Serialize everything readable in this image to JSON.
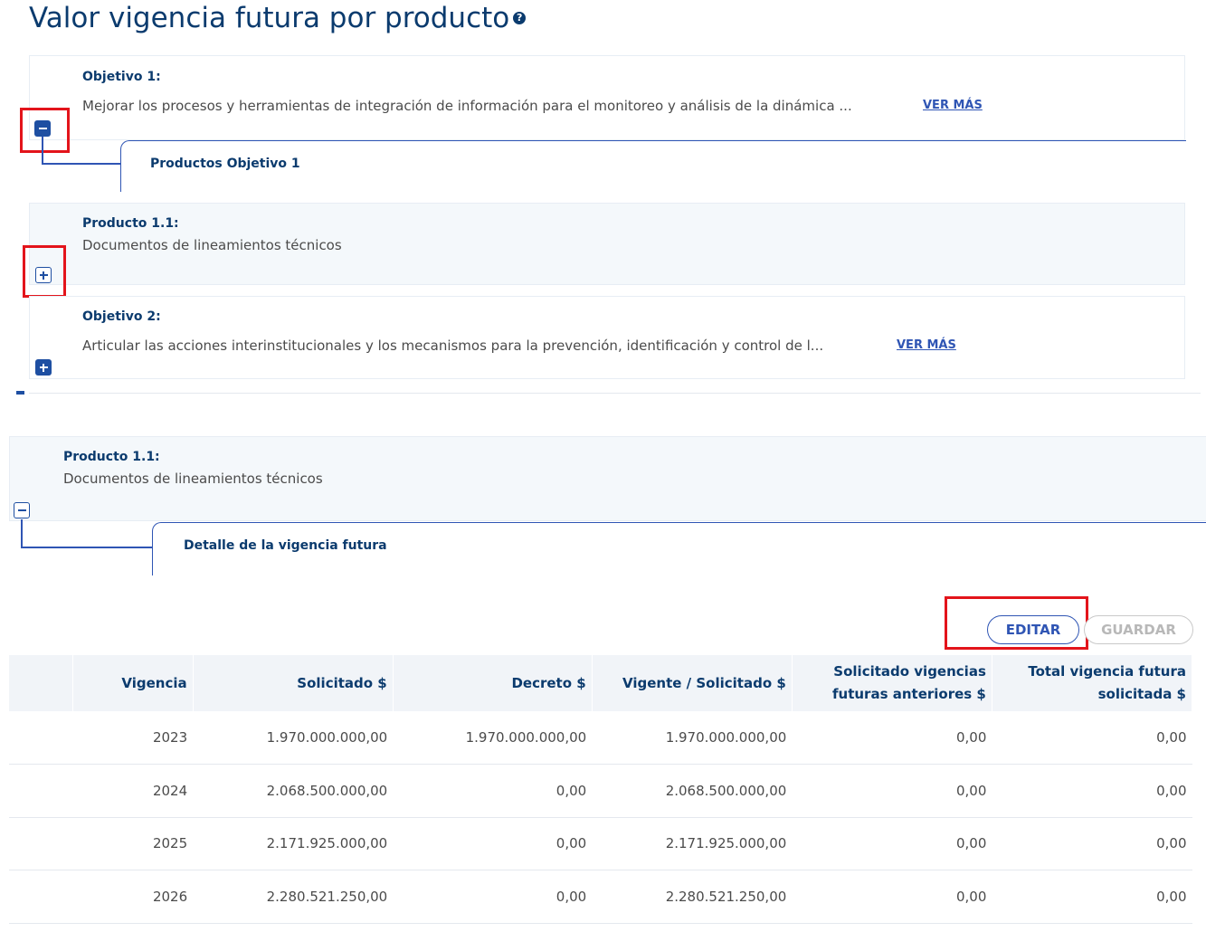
{
  "page": {
    "title": "Valor vigencia futura por producto",
    "help_glyph": "?"
  },
  "objetivo1": {
    "label": "Objetivo 1:",
    "text": "Mejorar los procesos y herramientas de integración de información para el monitoreo y análisis de la dinámica ...",
    "link": "VER MÁS",
    "products_tab": "Productos Objetivo 1",
    "producto": {
      "label": "Producto 1.1:",
      "text": "Documentos de lineamientos técnicos"
    }
  },
  "objetivo2": {
    "label": "Objetivo 2:",
    "text": "Articular las acciones interinstitucionales y los mecanismos para la prevención, identificación y control de l...",
    "link": "VER MÁS"
  },
  "detalle": {
    "producto_label": "Producto 1.1:",
    "producto_text": "Documentos de lineamientos técnicos",
    "tab": "Detalle de la vigencia futura",
    "edit_label": "EDITAR",
    "save_label": "GUARDAR"
  },
  "table": {
    "headers": {
      "vigencia": "Vigencia",
      "solicitado": "Solicitado $",
      "decreto": "Decreto $",
      "vigente": "Vigente / Solicitado $",
      "anteriores_1": "Solicitado vigencias",
      "anteriores_2": "futuras anteriores $",
      "total_1": "Total vigencia futura",
      "total_2": "solicitada $"
    },
    "rows": [
      {
        "vigencia": "2023",
        "solicitado": "1.970.000.000,00",
        "decreto": "1.970.000.000,00",
        "vigente": "1.970.000.000,00",
        "anteriores": "0,00",
        "total": "0,00"
      },
      {
        "vigencia": "2024",
        "solicitado": "2.068.500.000,00",
        "decreto": "0,00",
        "vigente": "2.068.500.000,00",
        "anteriores": "0,00",
        "total": "0,00"
      },
      {
        "vigencia": "2025",
        "solicitado": "2.171.925.000,00",
        "decreto": "0,00",
        "vigente": "2.171.925.000,00",
        "anteriores": "0,00",
        "total": "0,00"
      },
      {
        "vigencia": "2026",
        "solicitado": "2.280.521.250,00",
        "decreto": "0,00",
        "vigente": "2.280.521.250,00",
        "anteriores": "0,00",
        "total": "0,00"
      }
    ]
  },
  "colors": {
    "primary": "#1e4fa2",
    "title": "#0b3b6e",
    "highlight": "#e3141b"
  }
}
